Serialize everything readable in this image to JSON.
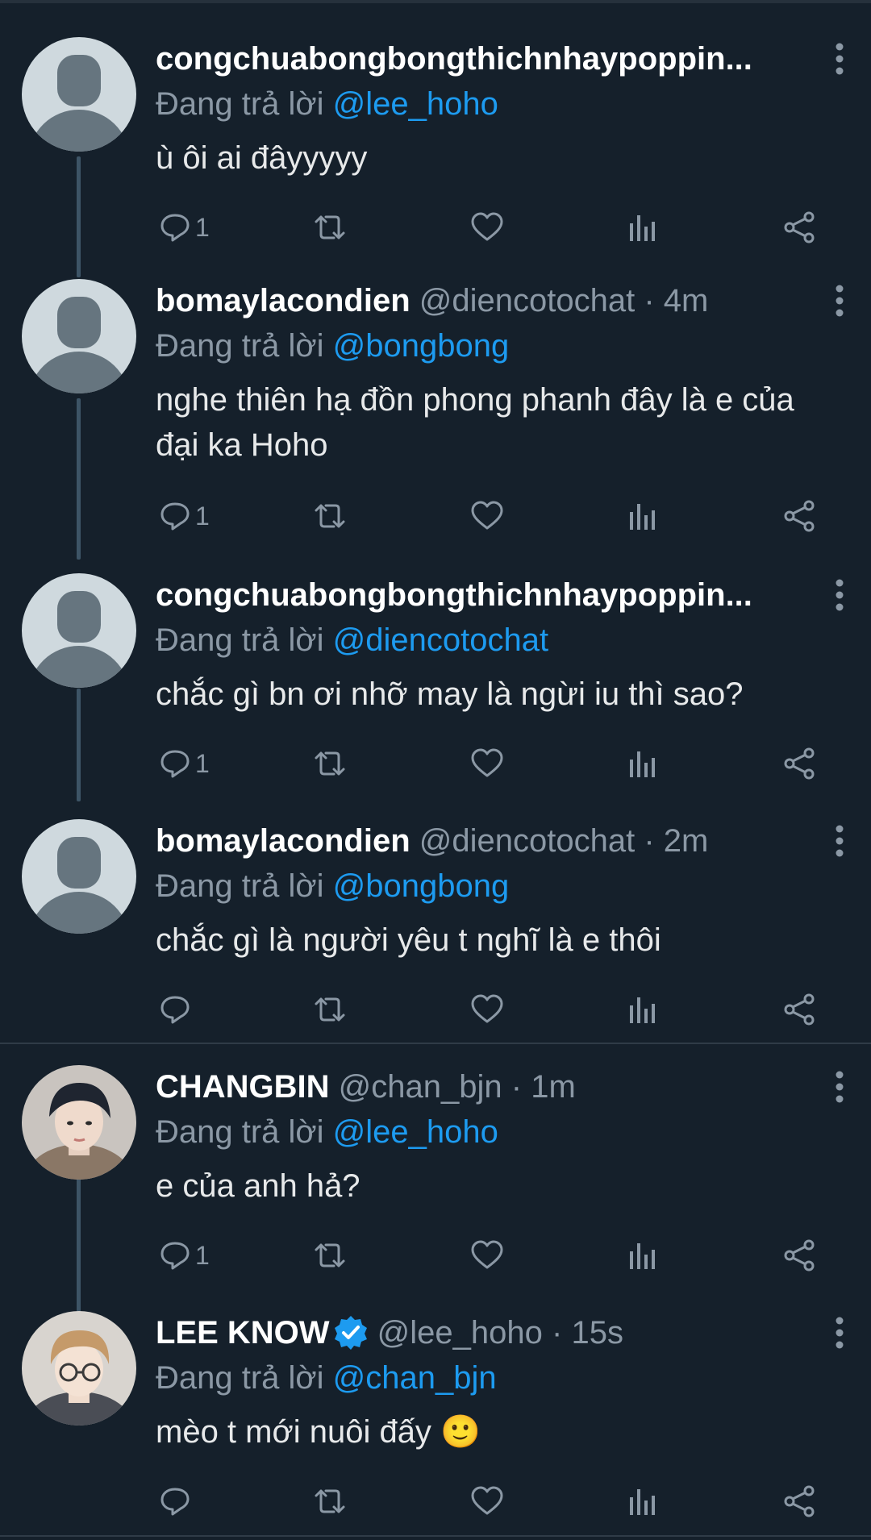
{
  "labels": {
    "replying_to": "Đang trả lời"
  },
  "colors": {
    "background": "#15202b",
    "accent": "#1d9bf0",
    "muted": "#8b98a5",
    "thread_line": "#3d5466"
  },
  "tweets": [
    {
      "name": "congchuabongbongthichnhaypoppin...",
      "handle": "",
      "time": "",
      "replying_to": "@lee_hoho",
      "text": "ù ôi ai đâyyyyy",
      "reply_count": "1",
      "avatar": "default-avatar"
    },
    {
      "name": "bomaylacondien",
      "handle": "@diencotochat",
      "time": "4m",
      "replying_to": "@bongbong",
      "text": "nghe thiên hạ đồn phong phanh đây là e của đại ka Hoho",
      "reply_count": "1",
      "avatar": "default-avatar"
    },
    {
      "name": "congchuabongbongthichnhaypoppin...",
      "handle": "",
      "time": "",
      "replying_to": "@diencotochat",
      "text": "chắc gì bn ơi nhỡ may là ngừi iu thì sao?",
      "reply_count": "1",
      "avatar": "default-avatar"
    },
    {
      "name": "bomaylacondien",
      "handle": "@diencotochat",
      "time": "2m",
      "replying_to": "@bongbong",
      "text": "chắc gì là người yêu t nghĩ là e thôi",
      "reply_count": "",
      "avatar": "default-avatar"
    },
    {
      "name": "CHANGBIN",
      "handle": "@chan_bjn",
      "time": "1m",
      "replying_to": "@lee_hoho",
      "text": "e của anh hả?",
      "reply_count": "1",
      "avatar": "photo-avatar"
    },
    {
      "name": "LEE KNOW",
      "handle": "@lee_hoho",
      "time": "15s",
      "replying_to": "@chan_bjn",
      "text": "mèo t mới nuôi đấy 🙂",
      "reply_count": "",
      "avatar": "photo-avatar",
      "verified": true
    }
  ]
}
